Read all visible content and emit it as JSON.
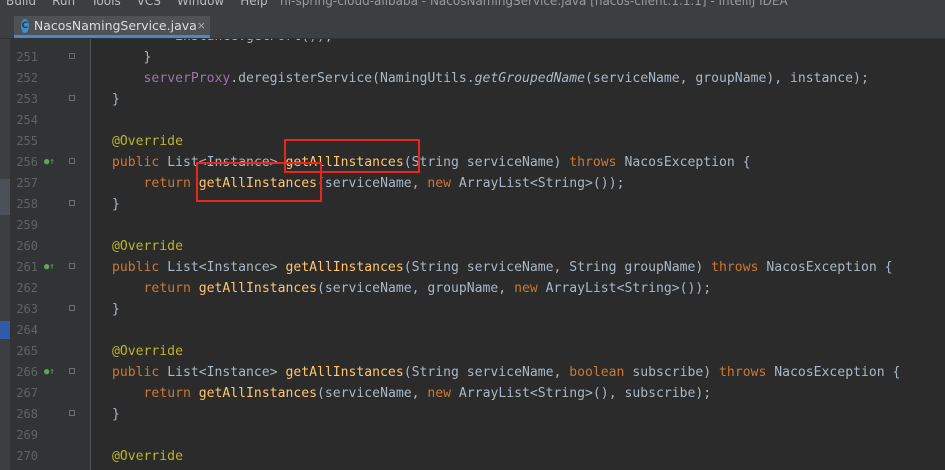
{
  "menu": {
    "items": [
      "Build",
      "Run",
      "Tools",
      "VCS",
      "Window",
      "Help"
    ],
    "window_title": "nf-spring-cloud-alibaba - NacosNamingService.java [nacos-client:1.1.1] - IntelliJ IDEA"
  },
  "tab": {
    "file_icon": "C",
    "label": "NacosNamingService.java",
    "close": "×"
  },
  "code": {
    "partial_top": "        instance.getPort());",
    "lines": [
      {
        "n": "251",
        "t": "    }"
      },
      {
        "n": "252",
        "t": "    serverProxy.deregisterService(NamingUtils.getGroupedName(serviceName, groupName), instance);"
      },
      {
        "n": "253",
        "t": "}"
      },
      {
        "n": "254",
        "t": ""
      },
      {
        "n": "255",
        "t": "@Override"
      },
      {
        "n": "256",
        "t": "public List<Instance> getAllInstances(String serviceName) throws NacosException {"
      },
      {
        "n": "257",
        "t": "    return getAllInstances(serviceName, new ArrayList<String>());"
      },
      {
        "n": "258",
        "t": "}"
      },
      {
        "n": "259",
        "t": ""
      },
      {
        "n": "260",
        "t": "@Override"
      },
      {
        "n": "261",
        "t": "public List<Instance> getAllInstances(String serviceName, String groupName) throws NacosException {"
      },
      {
        "n": "262",
        "t": "    return getAllInstances(serviceName, groupName, new ArrayList<String>());"
      },
      {
        "n": "263",
        "t": "}"
      },
      {
        "n": "264",
        "t": ""
      },
      {
        "n": "265",
        "t": "@Override"
      },
      {
        "n": "266",
        "t": "public List<Instance> getAllInstances(String serviceName, boolean subscribe) throws NacosException {"
      },
      {
        "n": "267",
        "t": "    return getAllInstances(serviceName, new ArrayList<String>(), subscribe);"
      },
      {
        "n": "268",
        "t": "}"
      },
      {
        "n": "269",
        "t": ""
      },
      {
        "n": "270",
        "t": "@Override"
      }
    ]
  },
  "gutter_markers": {
    "override_icon": "override-implement-icon",
    "glyph": "●↑"
  },
  "colors": {
    "background": "#2b2b2b",
    "keyword": "#cc7832",
    "method": "#ffc66d",
    "annotation": "#bbb529",
    "field": "#9876aa",
    "text": "#a9b7c6",
    "highlight_box": "#e8261c"
  }
}
